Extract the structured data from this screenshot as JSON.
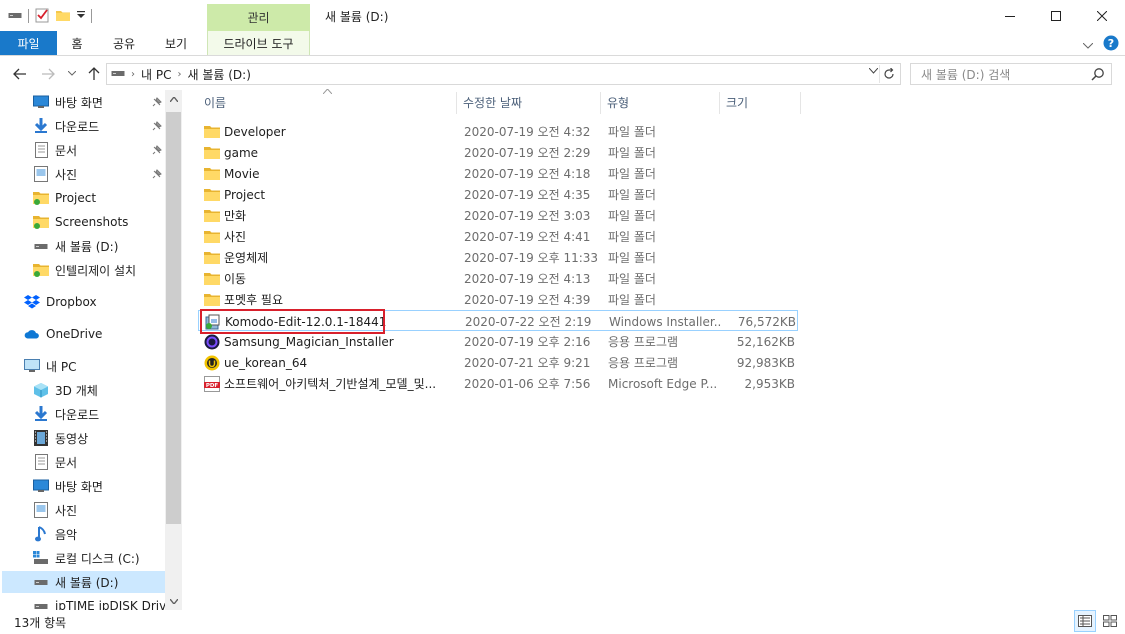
{
  "window": {
    "title": "새 볼륨 (D:)",
    "context_group": "관리"
  },
  "ribbon": {
    "tabs": [
      "파일",
      "홈",
      "공유",
      "보기",
      "드라이브 도구"
    ]
  },
  "address": {
    "crumbs": [
      "내 PC",
      "새 볼륨 (D:)"
    ],
    "search_placeholder": "새 볼륨 (D:) 검색"
  },
  "nav": {
    "items": [
      {
        "label": "바탕 화면",
        "icon": "desktop-icon",
        "pinned": true
      },
      {
        "label": "다운로드",
        "icon": "download-icon",
        "pinned": true
      },
      {
        "label": "문서",
        "icon": "document-icon",
        "pinned": true
      },
      {
        "label": "사진",
        "icon": "pictures-icon",
        "pinned": true
      },
      {
        "label": "Project",
        "icon": "folder-icon",
        "pinned": false
      },
      {
        "label": "Screenshots",
        "icon": "folder-icon",
        "pinned": false
      },
      {
        "label": "새 볼륨 (D:)",
        "icon": "drive-icon",
        "pinned": false
      },
      {
        "label": "인텔리제이 설치",
        "icon": "folder-icon",
        "pinned": false
      },
      {
        "label": "Dropbox",
        "icon": "dropbox-icon",
        "pinned": false
      },
      {
        "label": "OneDrive",
        "icon": "onedrive-icon",
        "pinned": false
      },
      {
        "label": "내 PC",
        "icon": "pc-icon",
        "pinned": false
      },
      {
        "label": "3D 개체",
        "icon": "3d-objects-icon",
        "pinned": false
      },
      {
        "label": "다운로드",
        "icon": "download-icon",
        "pinned": false
      },
      {
        "label": "동영상",
        "icon": "video-icon",
        "pinned": false
      },
      {
        "label": "문서",
        "icon": "document-icon",
        "pinned": false
      },
      {
        "label": "바탕 화면",
        "icon": "desktop-icon",
        "pinned": false
      },
      {
        "label": "사진",
        "icon": "pictures-icon",
        "pinned": false
      },
      {
        "label": "음악",
        "icon": "music-icon",
        "pinned": false
      },
      {
        "label": "로컬 디스크 (C:)",
        "icon": "windows-drive-icon",
        "pinned": false
      },
      {
        "label": "새 볼륨 (D:)",
        "icon": "drive-icon",
        "pinned": false,
        "selected": true
      },
      {
        "label": "ipTIME ipDISK Drive",
        "icon": "drive-icon",
        "pinned": false
      }
    ]
  },
  "columns": {
    "name": "이름",
    "date": "수정한 날짜",
    "type": "유형",
    "size": "크기"
  },
  "files": [
    {
      "name": "Developer",
      "date": "2020-07-19 오전 4:32",
      "type": "파일 폴더",
      "size": "",
      "icon": "folder-icon"
    },
    {
      "name": "game",
      "date": "2020-07-19 오전 2:29",
      "type": "파일 폴더",
      "size": "",
      "icon": "folder-icon"
    },
    {
      "name": "Movie",
      "date": "2020-07-19 오전 4:18",
      "type": "파일 폴더",
      "size": "",
      "icon": "folder-icon"
    },
    {
      "name": "Project",
      "date": "2020-07-19 오전 4:35",
      "type": "파일 폴더",
      "size": "",
      "icon": "folder-icon"
    },
    {
      "name": "만화",
      "date": "2020-07-19 오전 3:03",
      "type": "파일 폴더",
      "size": "",
      "icon": "folder-icon"
    },
    {
      "name": "사진",
      "date": "2020-07-19 오전 4:41",
      "type": "파일 폴더",
      "size": "",
      "icon": "folder-icon"
    },
    {
      "name": "운영체제",
      "date": "2020-07-19 오후 11:33",
      "type": "파일 폴더",
      "size": "",
      "icon": "folder-icon"
    },
    {
      "name": "이동",
      "date": "2020-07-19 오전 4:13",
      "type": "파일 폴더",
      "size": "",
      "icon": "folder-icon"
    },
    {
      "name": "포멧후 필요",
      "date": "2020-07-19 오전 4:39",
      "type": "파일 폴더",
      "size": "",
      "icon": "folder-icon"
    },
    {
      "name": "Komodo-Edit-12.0.1-18441",
      "date": "2020-07-22 오전 2:19",
      "type": "Windows Installer...",
      "size": "76,572KB",
      "icon": "msi-installer-icon",
      "highlighted": true
    },
    {
      "name": "Samsung_Magician_Installer",
      "date": "2020-07-19 오후 2:16",
      "type": "응용 프로그램",
      "size": "52,162KB",
      "icon": "magician-app-icon"
    },
    {
      "name": "ue_korean_64",
      "date": "2020-07-21 오후 9:21",
      "type": "응용 프로그램",
      "size": "92,983KB",
      "icon": "ue-app-icon"
    },
    {
      "name": "소프트웨어_아키텍처_기반설계_모델_및...",
      "date": "2020-01-06 오후 7:56",
      "type": "Microsoft Edge P...",
      "size": "2,953KB",
      "icon": "pdf-icon"
    }
  ],
  "status": {
    "item_count": "13개 항목"
  },
  "colors": {
    "accent": "#1979ca",
    "context_tab": "#cdeaa9",
    "selection": "#cce8ff",
    "highlight_box": "#d8202c"
  }
}
